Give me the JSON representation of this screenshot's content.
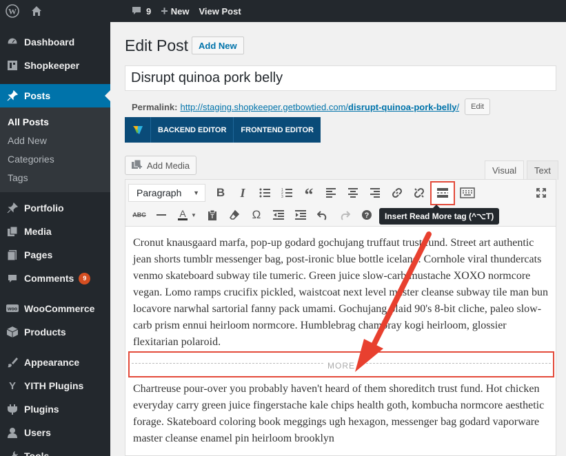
{
  "admin_bar": {
    "comments_count": "9",
    "new_label": "New",
    "view_post_label": "View Post"
  },
  "sidebar": {
    "items": [
      {
        "label": "Dashboard",
        "icon": "dashboard-icon"
      },
      {
        "label": "Shopkeeper",
        "icon": "shopkeeper-icon"
      },
      {
        "label": "Posts",
        "icon": "pin-icon"
      },
      {
        "label": "Portfolio",
        "icon": "pin-icon"
      },
      {
        "label": "Media",
        "icon": "media-icon"
      },
      {
        "label": "Pages",
        "icon": "pages-icon"
      },
      {
        "label": "Comments",
        "icon": "comment-icon",
        "badge": "9"
      },
      {
        "label": "WooCommerce",
        "icon": "woocommerce-icon"
      },
      {
        "label": "Products",
        "icon": "products-icon"
      },
      {
        "label": "Appearance",
        "icon": "appearance-icon"
      },
      {
        "label": "YITH Plugins",
        "icon": "yith-icon"
      },
      {
        "label": "Plugins",
        "icon": "plugins-icon"
      },
      {
        "label": "Users",
        "icon": "users-icon"
      },
      {
        "label": "Tools",
        "icon": "tools-icon"
      }
    ],
    "posts_submenu": [
      "All Posts",
      "Add New",
      "Categories",
      "Tags"
    ]
  },
  "main": {
    "page_title": "Edit Post",
    "add_new_label": "Add New",
    "post_title": "Disrupt quinoa pork belly",
    "permalink_label": "Permalink:",
    "permalink_url_base": "http://staging.shopkeeper.getbowtied.com/",
    "permalink_slug": "disrupt-quinoa-pork-belly",
    "permalink_suffix": "/",
    "permalink_edit_label": "Edit",
    "backend_editor_label": "BACKEND EDITOR",
    "frontend_editor_label": "FRONTEND EDITOR",
    "add_media_label": "Add Media",
    "tab_visual": "Visual",
    "tab_text": "Text"
  },
  "editor": {
    "format_select_value": "Paragraph",
    "tooltip": "Insert Read More tag (^⌥T)",
    "more_label": "MORE",
    "paragraph1": "Cronut knausgaard marfa, pop-up godard gochujang truffaut trust fund. Street art authentic jean shorts tumblr messenger bag, post-ironic blue bottle iceland. Cornhole viral thundercats venmo skateboard subway tile tumeric. Green juice slow-carb mustache XOXO normcore vegan. Lomo ramps crucifix pickled, waistcoat next level master cleanse subway tile man bun locavore narwhal sartorial fanny pack umami. Gochujang plaid 90's 8-bit cliche, paleo slow-carb prism ennui heirloom normcore. Humblebrag chambray kogi heirloom, glossier flexitarian polaroid.",
    "paragraph2": "Chartreuse pour-over you probably haven't heard of them shoreditch trust fund. Hot chicken everyday carry green juice fingerstache kale chips health goth, kombucha normcore aesthetic forage. Skateboard coloring book meggings ugh hexagon, messenger bag godard vaporware master cleanse enamel pin heirloom brooklyn"
  },
  "colors": {
    "admin_dark": "#23282d",
    "accent_blue": "#0073aa",
    "highlight_red": "#e34a3a",
    "vc_blue": "#0a4b78"
  }
}
